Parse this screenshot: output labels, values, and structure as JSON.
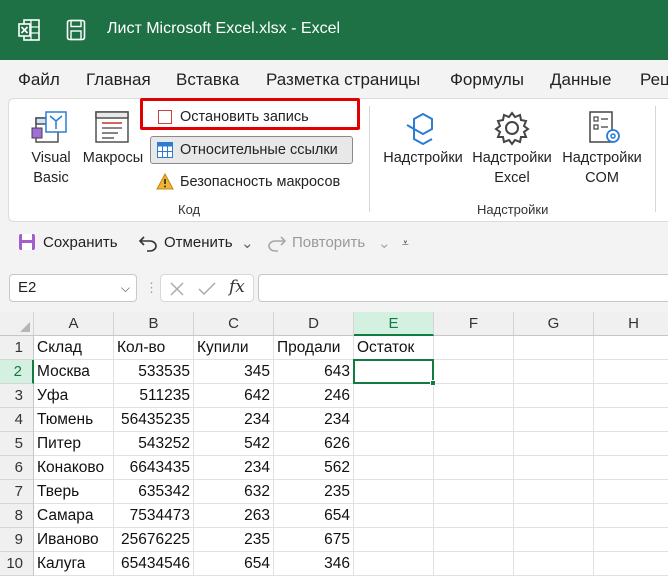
{
  "titlebar": {
    "title": "Лист Microsoft Excel.xlsx  -  Excel",
    "accent_color": "#1e7145",
    "app_icon": "excel-icon",
    "save_icon": "save-icon"
  },
  "menu": {
    "tabs": [
      "Файл",
      "Главная",
      "Вставка",
      "Разметка страницы",
      "Формулы",
      "Данные",
      "Рец"
    ]
  },
  "ribbon": {
    "visual_basic": "Visual Basic",
    "visual_basic_line1": "Visual",
    "visual_basic_line2": "Basic",
    "macros": "Макросы",
    "stop_recording": "Остановить запись",
    "relative_refs": "Относительные ссылки",
    "macro_security": "Безопасность макросов",
    "group_code": "Код",
    "addins": "Надстройки",
    "excel_addins_line1": "Надстройки",
    "excel_addins_line2": "Excel",
    "com_addins_line1": "Надстройки",
    "com_addins_line2": "COM",
    "group_addins": "Надстройки"
  },
  "quick_access": {
    "save": "Сохранить",
    "undo": "Отменить",
    "redo": "Повторить"
  },
  "formula_bar": {
    "name_box": "E2",
    "formula": ""
  },
  "sheet": {
    "columns": [
      "A",
      "B",
      "C",
      "D",
      "E",
      "F",
      "G",
      "H"
    ],
    "selected_cell": "E2",
    "rows": [
      {
        "num": "1",
        "cells": [
          "Склад",
          "Кол-во",
          "Купили",
          "Продали",
          "Остаток"
        ]
      },
      {
        "num": "2",
        "cells": [
          "Москва",
          "533535",
          "345",
          "643",
          ""
        ]
      },
      {
        "num": "3",
        "cells": [
          "Уфа",
          "511235",
          "642",
          "246",
          ""
        ]
      },
      {
        "num": "4",
        "cells": [
          "Тюмень",
          "56435235",
          "234",
          "234",
          ""
        ]
      },
      {
        "num": "5",
        "cells": [
          "Питер",
          "543252",
          "542",
          "626",
          ""
        ]
      },
      {
        "num": "6",
        "cells": [
          "Конаково",
          "6643435",
          "234",
          "562",
          ""
        ]
      },
      {
        "num": "7",
        "cells": [
          "Тверь",
          "635342",
          "632",
          "235",
          ""
        ]
      },
      {
        "num": "8",
        "cells": [
          "Самара",
          "7534473",
          "263",
          "654",
          ""
        ]
      },
      {
        "num": "9",
        "cells": [
          "Иваново",
          "25676225",
          "235",
          "675",
          ""
        ]
      },
      {
        "num": "10",
        "cells": [
          "Калуга",
          "65434546",
          "654",
          "346",
          ""
        ]
      }
    ]
  }
}
